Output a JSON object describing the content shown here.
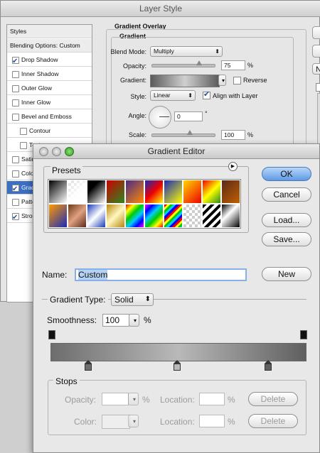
{
  "layer_style": {
    "title": "Layer Style",
    "sidebar": {
      "header": "Styles",
      "blending": "Blending Options: Custom",
      "items": [
        {
          "label": "Drop Shadow",
          "checked": true
        },
        {
          "label": "Inner Shadow",
          "checked": false
        },
        {
          "label": "Outer Glow",
          "checked": false
        },
        {
          "label": "Inner Glow",
          "checked": false
        },
        {
          "label": "Bevel and Emboss",
          "checked": false
        },
        {
          "label": "Contour",
          "checked": false
        },
        {
          "label": "Texture",
          "checked": false
        },
        {
          "label": "Satin",
          "checked": false
        },
        {
          "label": "Color Overlay",
          "checked": false
        },
        {
          "label": "Gradient Overlay",
          "checked": true
        },
        {
          "label": "Pattern Overlay",
          "checked": false
        },
        {
          "label": "Stroke",
          "checked": true
        }
      ]
    },
    "gradient_overlay": {
      "section_title": "Gradient Overlay",
      "group_title": "Gradient",
      "blend_mode_label": "Blend Mode:",
      "blend_mode_value": "Multiply",
      "opacity_label": "Opacity:",
      "opacity_value": "75",
      "opacity_unit": "%",
      "gradient_label": "Gradient:",
      "reverse_label": "Reverse",
      "style_label": "Style:",
      "style_value": "Linear",
      "align_label": "Align with Layer",
      "angle_label": "Angle:",
      "angle_value": "0",
      "angle_unit": "°",
      "scale_label": "Scale:",
      "scale_value": "100",
      "scale_unit": "%"
    },
    "right_buttons": [
      "",
      "",
      "N",
      ""
    ]
  },
  "gradient_editor": {
    "title": "Gradient Editor",
    "presets_label": "Presets",
    "buttons": {
      "ok": "OK",
      "cancel": "Cancel",
      "load": "Load...",
      "save": "Save...",
      "new": "New"
    },
    "name_label": "Name:",
    "name_value": "Custom",
    "gradient_type_label": "Gradient Type:",
    "gradient_type_value": "Solid",
    "smoothness_label": "Smoothness:",
    "smoothness_value": "100",
    "smoothness_unit": "%",
    "gradient_colors": [
      "#6d6d6d",
      "#b9b9b9",
      "#5f5f5f"
    ],
    "stops": {
      "title": "Stops",
      "opacity_label": "Opacity:",
      "opacity_unit": "%",
      "location_label": "Location:",
      "location_unit": "%",
      "delete_label": "Delete",
      "color_label": "Color:",
      "location2_label": "Location:",
      "location2_unit": "%",
      "delete2_label": "Delete"
    }
  }
}
